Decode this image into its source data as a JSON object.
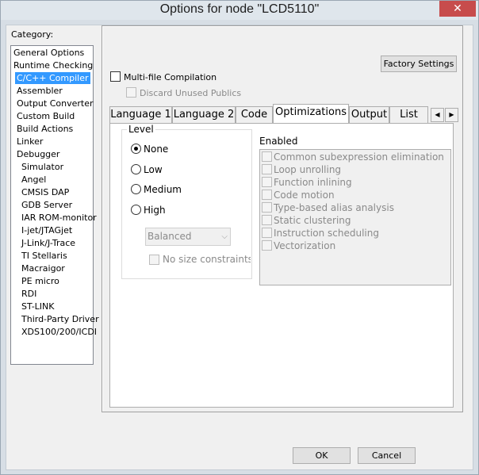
{
  "window": {
    "title": "Options for node \"LCD5110\"",
    "close": "✕"
  },
  "category": {
    "label": "Category:",
    "items": [
      {
        "label": "General Options",
        "indent": 0,
        "selected": false
      },
      {
        "label": "Runtime Checking",
        "indent": 0,
        "selected": false
      },
      {
        "label": "C/C++ Compiler",
        "indent": 1,
        "selected": true
      },
      {
        "label": "Assembler",
        "indent": 1,
        "selected": false
      },
      {
        "label": "Output Converter",
        "indent": 1,
        "selected": false
      },
      {
        "label": "Custom Build",
        "indent": 1,
        "selected": false
      },
      {
        "label": "Build Actions",
        "indent": 1,
        "selected": false
      },
      {
        "label": "Linker",
        "indent": 1,
        "selected": false
      },
      {
        "label": "Debugger",
        "indent": 1,
        "selected": false
      },
      {
        "label": "Simulator",
        "indent": 2,
        "selected": false
      },
      {
        "label": "Angel",
        "indent": 2,
        "selected": false
      },
      {
        "label": "CMSIS DAP",
        "indent": 2,
        "selected": false
      },
      {
        "label": "GDB Server",
        "indent": 2,
        "selected": false
      },
      {
        "label": "IAR ROM-monitor",
        "indent": 2,
        "selected": false
      },
      {
        "label": "I-jet/JTAGjet",
        "indent": 2,
        "selected": false
      },
      {
        "label": "J-Link/J-Trace",
        "indent": 2,
        "selected": false
      },
      {
        "label": "TI Stellaris",
        "indent": 2,
        "selected": false
      },
      {
        "label": "Macraigor",
        "indent": 2,
        "selected": false
      },
      {
        "label": "PE micro",
        "indent": 2,
        "selected": false
      },
      {
        "label": "RDI",
        "indent": 2,
        "selected": false
      },
      {
        "label": "ST-LINK",
        "indent": 2,
        "selected": false
      },
      {
        "label": "Third-Party Driver",
        "indent": 2,
        "selected": false
      },
      {
        "label": "XDS100/200/ICDI",
        "indent": 2,
        "selected": false
      }
    ]
  },
  "panel": {
    "factory_settings": "Factory Settings",
    "multi_file": "Multi-file Compilation",
    "discard_unused": "Discard Unused Publics",
    "tabs": [
      {
        "label": "Language 1",
        "active": false
      },
      {
        "label": "Language 2",
        "active": false
      },
      {
        "label": "Code",
        "active": false
      },
      {
        "label": "Optimizations",
        "active": true
      },
      {
        "label": "Output",
        "active": false
      },
      {
        "label": "List",
        "active": false
      }
    ],
    "arrow_left": "◀",
    "arrow_right": "▶",
    "level": {
      "title": "Level",
      "options": [
        "None",
        "Low",
        "Medium",
        "High"
      ],
      "selected": "None",
      "combo_value": "Balanced",
      "combo_arrow": "⌵",
      "no_size": "No size constraints"
    },
    "enabled": {
      "title": "Enabled",
      "items": [
        "Common subexpression elimination",
        "Loop unrolling",
        "Function inlining",
        "Code motion",
        "Type-based alias analysis",
        "Static clustering",
        "Instruction scheduling",
        "Vectorization"
      ]
    }
  },
  "buttons": {
    "ok": "OK",
    "cancel": "Cancel"
  }
}
